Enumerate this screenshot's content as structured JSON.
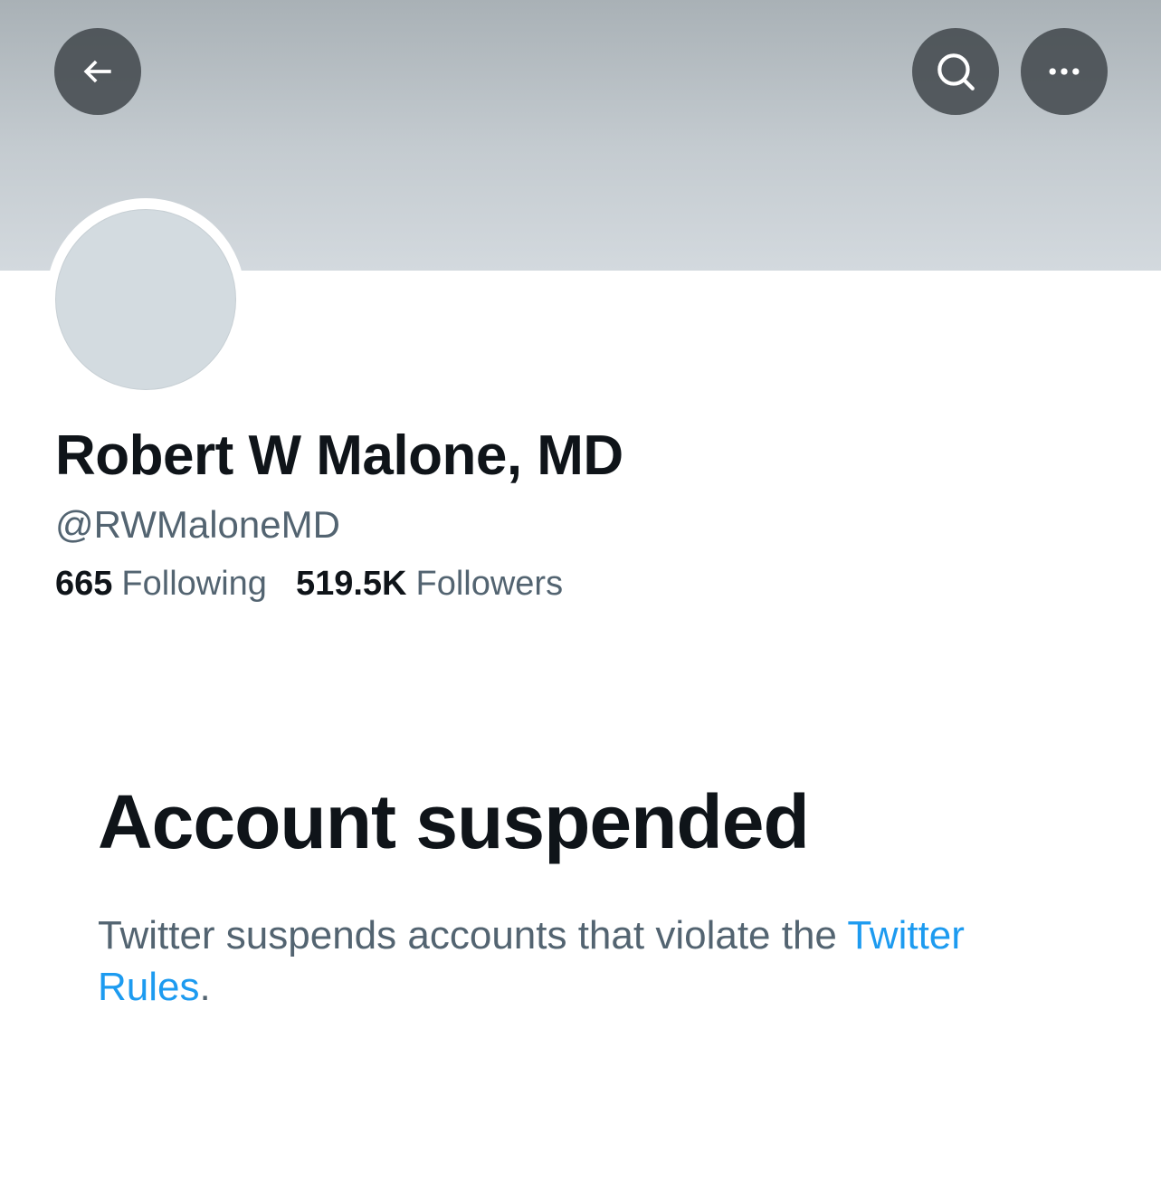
{
  "header": {
    "back_icon": "back-arrow-icon",
    "search_icon": "search-icon",
    "more_icon": "more-dots-icon"
  },
  "profile": {
    "display_name": "Robert W Malone, MD",
    "handle": "@RWMaloneMD",
    "following_count": "665",
    "following_label": "Following",
    "followers_count": "519.5K",
    "followers_label": "Followers"
  },
  "suspension": {
    "title": "Account suspended",
    "description": "Twitter suspends accounts that violate the",
    "link_text": "Twitter Rules",
    "trailing": "."
  },
  "colors": {
    "text_primary": "#0f1419",
    "text_secondary": "#536471",
    "link": "#1d9bf0",
    "banner": "#c4cbd0",
    "avatar_placeholder": "#d3dbe0"
  }
}
